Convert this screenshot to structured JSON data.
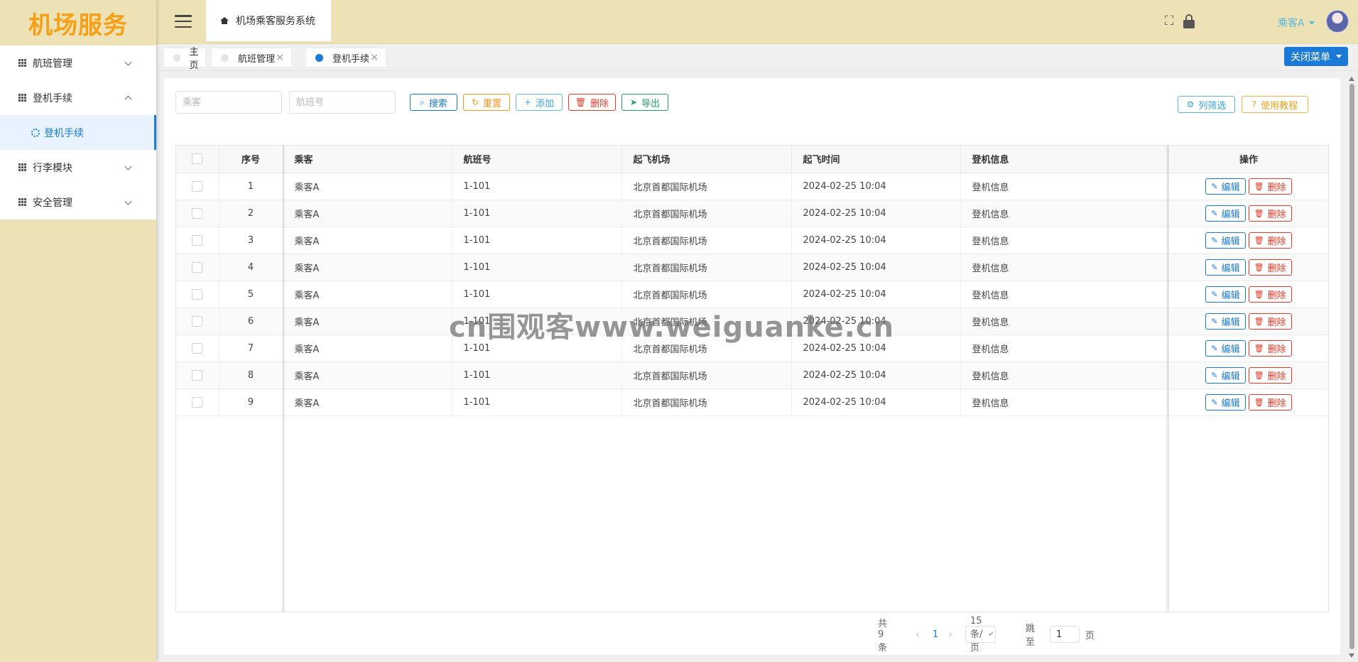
{
  "sidebar": {
    "logo": "机场服务",
    "menu": [
      {
        "label": "航班管理",
        "expanded": false
      },
      {
        "label": "登机手续",
        "expanded": true,
        "children": [
          {
            "label": "登机手续",
            "active": true
          }
        ]
      },
      {
        "label": "行李模块",
        "expanded": false
      },
      {
        "label": "安全管理",
        "expanded": false
      }
    ]
  },
  "header": {
    "system_title": "机场乘客服务系统",
    "user_name": "乘客A",
    "icons": [
      "menu-toggle-icon",
      "home-icon",
      "fullscreen-icon",
      "lock-icon",
      "avatar"
    ]
  },
  "tags": [
    {
      "label": "主页",
      "closable": false,
      "active": false
    },
    {
      "label": "航班管理",
      "closable": true,
      "active": false
    },
    {
      "label": "登机手续",
      "closable": true,
      "active": true
    }
  ],
  "close_menu_label": "关闭菜单",
  "filters": {
    "passenger_placeholder": "乘客",
    "flight_placeholder": "航班号"
  },
  "toolbar": {
    "search": "搜索",
    "reset": "重置",
    "add": "添加",
    "delete": "删除",
    "export": "导出",
    "column_filter": "列筛选",
    "tutorial": "使用教程"
  },
  "table": {
    "columns": [
      "序号",
      "乘客",
      "航班号",
      "起飞机场",
      "起飞时间",
      "登机信息",
      "操作"
    ],
    "edit_label": "编辑",
    "delete_label": "删除",
    "rows": [
      {
        "seq": "1",
        "passenger": "乘客A",
        "flight": "1-101",
        "airport": "北京首都国际机场",
        "time": "2024-02-25 10:04",
        "info": "登机信息"
      },
      {
        "seq": "2",
        "passenger": "乘客A",
        "flight": "1-101",
        "airport": "北京首都国际机场",
        "time": "2024-02-25 10:04",
        "info": "登机信息"
      },
      {
        "seq": "3",
        "passenger": "乘客A",
        "flight": "1-101",
        "airport": "北京首都国际机场",
        "time": "2024-02-25 10:04",
        "info": "登机信息"
      },
      {
        "seq": "4",
        "passenger": "乘客A",
        "flight": "1-101",
        "airport": "北京首都国际机场",
        "time": "2024-02-25 10:04",
        "info": "登机信息"
      },
      {
        "seq": "5",
        "passenger": "乘客A",
        "flight": "1-101",
        "airport": "北京首都国际机场",
        "time": "2024-02-25 10:04",
        "info": "登机信息"
      },
      {
        "seq": "6",
        "passenger": "乘客A",
        "flight": "1-101",
        "airport": "北京首都国际机场",
        "time": "2024-02-25 10:04",
        "info": "登机信息"
      },
      {
        "seq": "7",
        "passenger": "乘客A",
        "flight": "1-101",
        "airport": "北京首都国际机场",
        "time": "2024-02-25 10:04",
        "info": "登机信息"
      },
      {
        "seq": "8",
        "passenger": "乘客A",
        "flight": "1-101",
        "airport": "北京首都国际机场",
        "time": "2024-02-25 10:04",
        "info": "登机信息"
      },
      {
        "seq": "9",
        "passenger": "乘客A",
        "flight": "1-101",
        "airport": "北京首都国际机场",
        "time": "2024-02-25 10:04",
        "info": "登机信息"
      }
    ]
  },
  "pagination": {
    "total_text": "共 9 条",
    "current_page": "1",
    "page_size": "15 条/页",
    "jump_label": "跳至",
    "jump_value": "1",
    "page_suffix": "页"
  },
  "watermark": "cn围观客www.weiguanke.cn",
  "colors": {
    "sidebar_bg": "#ede2b6",
    "logo": "#f5a016",
    "primary": "#1a7ad6",
    "danger": "#e23b2a",
    "warning": "#f2961c",
    "success": "#21a266",
    "user_name": "#5eb8d6"
  }
}
